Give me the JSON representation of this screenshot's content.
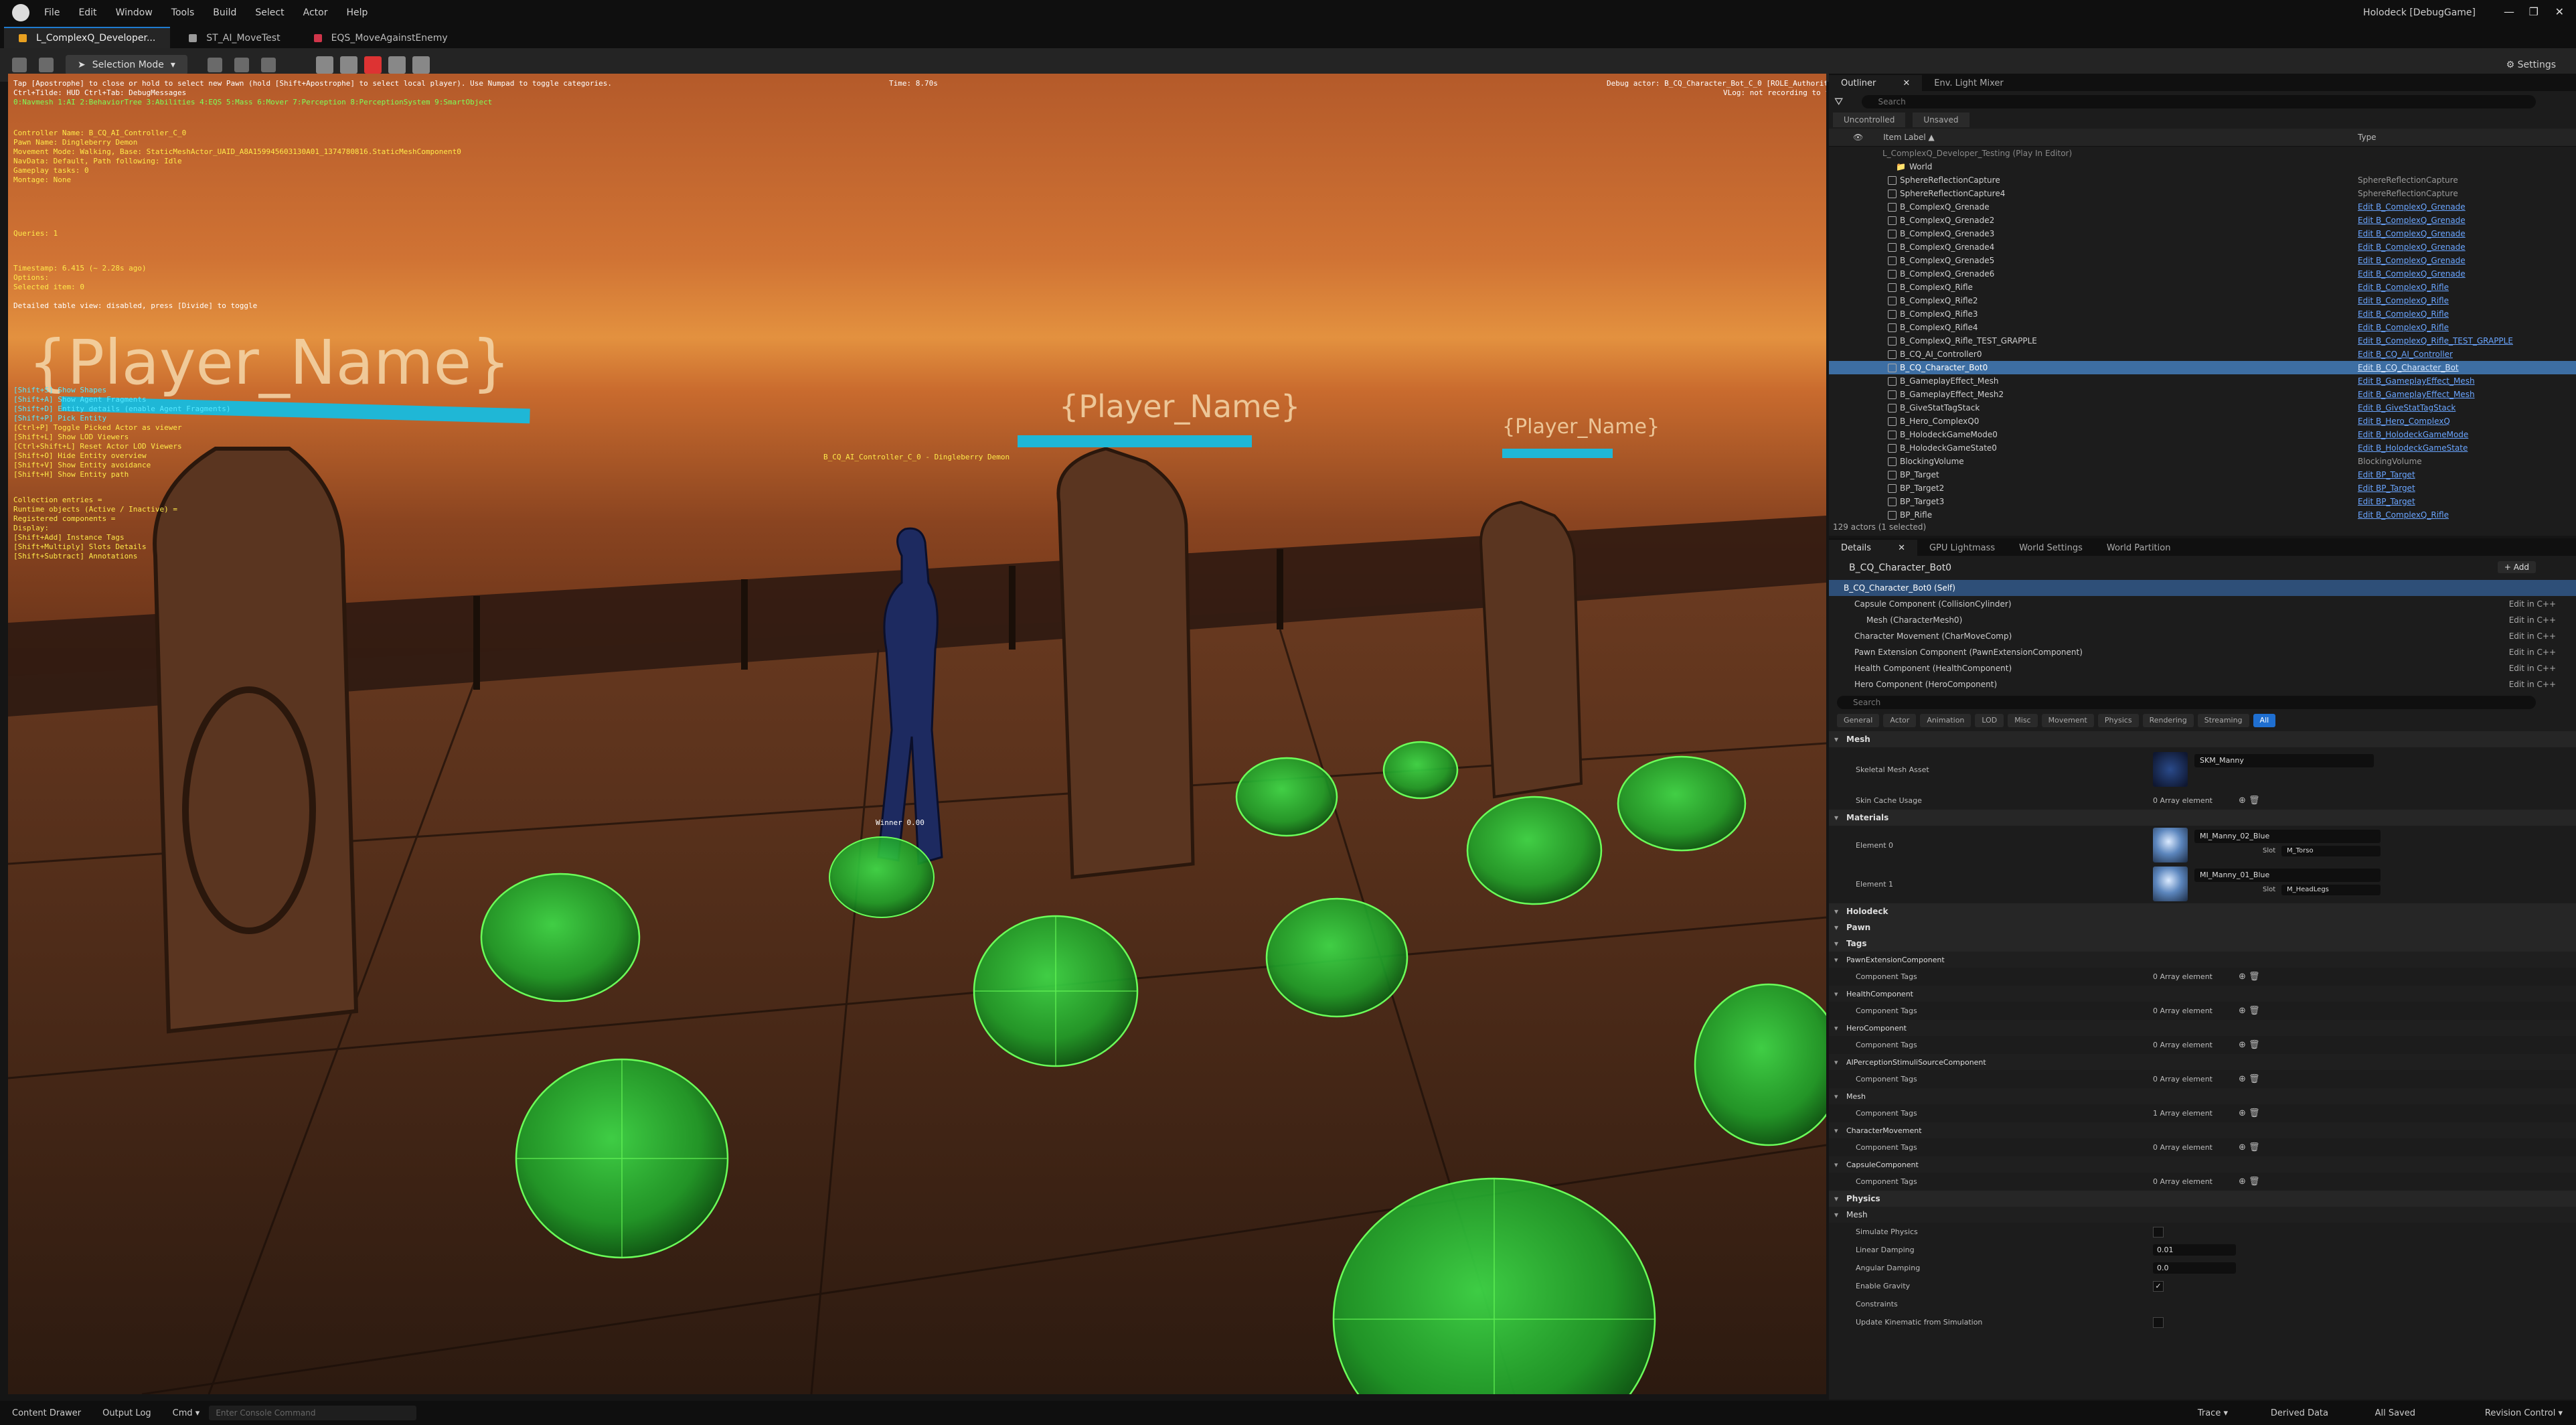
{
  "menu": {
    "items": [
      "File",
      "Edit",
      "Window",
      "Tools",
      "Build",
      "Select",
      "Actor",
      "Help"
    ],
    "project": "Holodeck [DebugGame]"
  },
  "tabs": [
    {
      "label": "L_ComplexQ_Developer..."
    },
    {
      "label": "ST_AI_MoveTest"
    },
    {
      "label": "EQS_MoveAgainstEnemy"
    }
  ],
  "toolbar": {
    "mode": "Selection Mode",
    "settings": "Settings"
  },
  "viewport": {
    "top_hint": "Tap [Apostrophe] to close or hold to select new Pawn (hold [Shift+Apostrophe] to select local player). Use Numpad to toggle categories.",
    "time": "Time: 8.70s",
    "debug_actor": "Debug actor: B_CQ_Character_Bot_C_0 [ROLE_Authority]",
    "vlog": "VLog: not recording to file",
    "hud_line": "Ctrl+Tilde: HUD  Ctrl+Tab: DebugMessages",
    "categories": "0:Navmesh  1:AI  2:BehaviorTree  3:Abilities  4:EQS  5:Mass  6:Mover  7:Perception  8:PerceptionSystem  9:SmartObject",
    "lines": [
      {
        "t": "Controller Name: B_CQ_AI_Controller_C_0",
        "c": "y"
      },
      {
        "t": "Pawn Name: Dingleberry Demon",
        "c": "y"
      },
      {
        "t": "Movement Mode: Walking, Base: StaticMeshActor_UAID_A8A159945603130A01_1374780816.StaticMeshComponent0",
        "c": "y"
      },
      {
        "t": "NavData: Default, Path following: Idle",
        "c": "y"
      },
      {
        "t": "Gameplay tasks: 0",
        "c": "y"
      },
      {
        "t": "Montage: None",
        "c": "y"
      },
      {
        "t": "Queries: 1",
        "c": "y"
      },
      {
        "t": "Timestamp: 6.415 (~ 2.28s ago)",
        "c": "y"
      },
      {
        "t": "Options:",
        "c": "y"
      },
      {
        "t": "Selected item: 0",
        "c": "y"
      },
      {
        "t": "Detailed table view: disabled, press [Divide] to toggle",
        "c": "w"
      },
      {
        "t": "[Shift+S] Show Shapes",
        "c": "c"
      },
      {
        "t": "[Shift+A] Show Agent Fragments",
        "c": "c"
      },
      {
        "t": "[Shift+D] Entity details (enable Agent Fragments)",
        "c": "c"
      },
      {
        "t": "[Shift+P] Pick Entity",
        "c": "c"
      },
      {
        "t": "[Ctrl+P] Toggle Picked Actor as viewer",
        "c": "y"
      },
      {
        "t": "[Shift+L] Show LOD Viewers",
        "c": "y"
      },
      {
        "t": "[Ctrl+Shift+L] Reset Actor LOD Viewers",
        "c": "y"
      },
      {
        "t": "[Shift+O] Hide Entity overview",
        "c": "y"
      },
      {
        "t": "[Shift+V] Show Entity avoidance",
        "c": "y"
      },
      {
        "t": "[Shift+H] Show Entity path",
        "c": "y"
      },
      {
        "t": "Collection entries =",
        "c": "y"
      },
      {
        "t": "Runtime objects (Active / Inactive) =",
        "c": "y"
      },
      {
        "t": "Registered components =",
        "c": "y"
      },
      {
        "t": "Display:",
        "c": "y"
      },
      {
        "t": "[Shift+Add] Instance Tags",
        "c": "y"
      },
      {
        "t": "[Shift+Multiply] Slots Details",
        "c": "y"
      },
      {
        "t": "[Shift+Subtract] Annotations",
        "c": "y"
      }
    ],
    "player_name": "{Player_Name}",
    "bot_label": "B_CQ_AI_Controller_C_0 - Dingleberry Demon",
    "winner_label": "Winner 0.00"
  },
  "outliner": {
    "tab": "Outliner",
    "tab2": "Env. Light Mixer",
    "search_placeholder": "Search",
    "filter1": "Unsaved",
    "col_label": "Item Label ▲",
    "col_type": "Type",
    "header_row": "L_ComplexQ_Developer_Testing (Play In Editor)",
    "world": "World",
    "rows": [
      {
        "label": "SphereReflectionCapture",
        "type": "SphereReflectionCapture",
        "link": false
      },
      {
        "label": "SphereReflectionCapture4",
        "type": "SphereReflectionCapture",
        "link": false
      },
      {
        "label": "B_ComplexQ_Grenade",
        "type": "Edit B_ComplexQ_Grenade",
        "link": true
      },
      {
        "label": "B_ComplexQ_Grenade2",
        "type": "Edit B_ComplexQ_Grenade",
        "link": true
      },
      {
        "label": "B_ComplexQ_Grenade3",
        "type": "Edit B_ComplexQ_Grenade",
        "link": true
      },
      {
        "label": "B_ComplexQ_Grenade4",
        "type": "Edit B_ComplexQ_Grenade",
        "link": true
      },
      {
        "label": "B_ComplexQ_Grenade5",
        "type": "Edit B_ComplexQ_Grenade",
        "link": true
      },
      {
        "label": "B_ComplexQ_Grenade6",
        "type": "Edit B_ComplexQ_Grenade",
        "link": true
      },
      {
        "label": "B_ComplexQ_Rifle",
        "type": "Edit B_ComplexQ_Rifle",
        "link": true
      },
      {
        "label": "B_ComplexQ_Rifle2",
        "type": "Edit B_ComplexQ_Rifle",
        "link": true
      },
      {
        "label": "B_ComplexQ_Rifle3",
        "type": "Edit B_ComplexQ_Rifle",
        "link": true
      },
      {
        "label": "B_ComplexQ_Rifle4",
        "type": "Edit B_ComplexQ_Rifle",
        "link": true
      },
      {
        "label": "B_ComplexQ_Rifle_TEST_GRAPPLE",
        "type": "Edit B_ComplexQ_Rifle_TEST_GRAPPLE",
        "link": true
      },
      {
        "label": "B_CQ_AI_Controller0",
        "type": "Edit B_CQ_AI_Controller",
        "link": true
      },
      {
        "label": "B_CQ_Character_Bot0",
        "type": "Edit B_CQ_Character_Bot",
        "link": true,
        "selected": true
      },
      {
        "label": "B_GameplayEffect_Mesh",
        "type": "Edit B_GameplayEffect_Mesh",
        "link": true
      },
      {
        "label": "B_GameplayEffect_Mesh2",
        "type": "Edit B_GameplayEffect_Mesh",
        "link": true
      },
      {
        "label": "B_GiveStatTagStack",
        "type": "Edit B_GiveStatTagStack",
        "link": true
      },
      {
        "label": "B_Hero_ComplexQ0",
        "type": "Edit B_Hero_ComplexQ",
        "link": true
      },
      {
        "label": "B_HolodeckGameMode0",
        "type": "Edit B_HolodeckGameMode",
        "link": true
      },
      {
        "label": "B_HolodeckGameState0",
        "type": "Edit B_HolodeckGameState",
        "link": true
      },
      {
        "label": "BlockingVolume",
        "type": "BlockingVolume",
        "link": false
      },
      {
        "label": "BP_Target",
        "type": "Edit BP_Target",
        "link": true
      },
      {
        "label": "BP_Target2",
        "type": "Edit BP_Target",
        "link": true
      },
      {
        "label": "BP_Target3",
        "type": "Edit BP_Target",
        "link": true
      },
      {
        "label": "BP_Rifle",
        "type": "Edit B_ComplexQ_Rifle",
        "link": true
      }
    ],
    "footer": "129 actors (1 selected)"
  },
  "details": {
    "tabs": [
      "Details",
      "GPU Lightmass",
      "World Settings",
      "World Partition"
    ],
    "actor": "B_CQ_Character_Bot0",
    "add": "+ Add",
    "components": [
      {
        "label": "B_CQ_Character_Bot0 (Self)",
        "edit": ""
      },
      {
        "label": "Capsule Component (CollisionCylinder)",
        "edit": "Edit in C++"
      },
      {
        "label": "Mesh (CharacterMesh0)",
        "edit": "Edit in C++"
      },
      {
        "label": "Character Movement (CharMoveComp)",
        "edit": "Edit in C++"
      },
      {
        "label": "Pawn Extension Component (PawnExtensionComponent)",
        "edit": "Edit in C++"
      },
      {
        "label": "Health Component (HealthComponent)",
        "edit": "Edit in C++"
      },
      {
        "label": "Hero Component (HeroComponent)",
        "edit": "Edit in C++"
      }
    ],
    "search_placeholder": "Search",
    "categories": [
      "General",
      "Actor",
      "Animation",
      "LOD",
      "Misc",
      "Movement",
      "Physics",
      "Rendering",
      "Streaming",
      "All"
    ],
    "mesh_section": "Mesh",
    "skeletal_mesh_label": "Skeletal Mesh Asset",
    "skeletal_mesh_value": "SKM_Manny",
    "skin_cache_label": "Skin Cache Usage",
    "skin_cache_value": "0 Array element",
    "materials_section": "Materials",
    "element0": "Element 0",
    "element0_value": "MI_Manny_02_Blue",
    "element0_slot": "M_Torso",
    "element1": "Element 1",
    "element1_value": "MI_Manny_01_Blue",
    "element1_slot": "M_HeadLegs",
    "slot_label": "Slot",
    "holodeck_section": "Holodeck",
    "pawn_section": "Pawn",
    "tags_section": "Tags",
    "tag_groups": [
      {
        "name": "PawnExtensionComponent",
        "prop": "Component Tags",
        "value": "0 Array element"
      },
      {
        "name": "HealthComponent",
        "prop": "Component Tags",
        "value": "0 Array element"
      },
      {
        "name": "HeroComponent",
        "prop": "Component Tags",
        "value": "0 Array element"
      },
      {
        "name": "AIPerceptionStimuliSourceComponent",
        "prop": "Component Tags",
        "value": "0 Array element"
      },
      {
        "name": "Mesh",
        "prop": "Component Tags",
        "value": "1 Array element"
      },
      {
        "name": "CharacterMovement",
        "prop": "Component Tags",
        "value": "0 Array element"
      },
      {
        "name": "CapsuleComponent",
        "prop": "Component Tags",
        "value": "0 Array element"
      }
    ],
    "physics_section": "Physics",
    "physics_mesh": "Mesh",
    "simulate_physics": "Simulate Physics",
    "linear_damping": "Linear Damping",
    "linear_damping_value": "0.01",
    "angular_damping": "Angular Damping",
    "angular_damping_value": "0.0",
    "enable_gravity": "Enable Gravity",
    "constraints": "Constraints",
    "update_kinematic": "Update Kinematic from Simulation"
  },
  "statusbar": {
    "content_drawer": "Content Drawer",
    "output_log": "Output Log",
    "cmd": "Cmd ▾",
    "cmd_placeholder": "Enter Console Command",
    "trace": "Trace ▾",
    "derived": "Derived Data",
    "saved": "All Saved",
    "revision": "Revision Control ▾"
  },
  "colors": {
    "accent": "#1f7bd0",
    "selection": "#3d6ea3",
    "link": "#6aa5ff",
    "sphere": "#1ea82a"
  }
}
